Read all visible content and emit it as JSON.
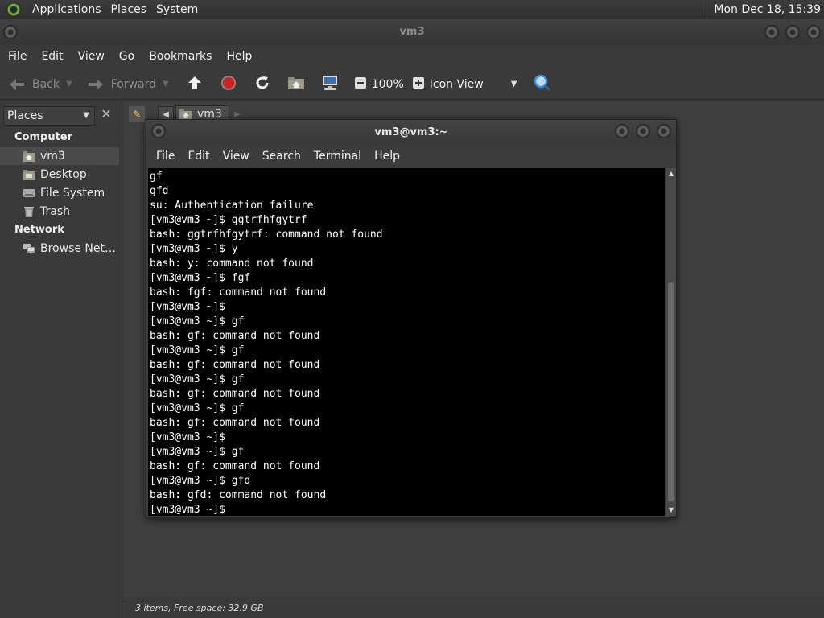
{
  "top_panel": {
    "menus": [
      "Applications",
      "Places",
      "System"
    ],
    "clock": "Mon Dec 18, 15:39"
  },
  "file_manager": {
    "title": "vm3",
    "menus": [
      "File",
      "Edit",
      "View",
      "Go",
      "Bookmarks",
      "Help"
    ],
    "toolbar": {
      "back": "Back",
      "forward": "Forward",
      "zoom": "100%",
      "view_mode": "Icon View"
    },
    "sidebar": {
      "combo": "Places",
      "sections": [
        {
          "heading": "Computer",
          "items": [
            "vm3",
            "Desktop",
            "File System",
            "Trash"
          ]
        },
        {
          "heading": "Network",
          "items": [
            "Browse Net…"
          ]
        }
      ]
    },
    "path": {
      "crumb": "vm3"
    },
    "status": "3 items, Free space: 32.9 GB"
  },
  "terminal": {
    "title": "vm3@vm3:~",
    "menus": [
      "File",
      "Edit",
      "View",
      "Search",
      "Terminal",
      "Help"
    ],
    "lines": [
      "gf",
      "gfd",
      "su: Authentication failure",
      "[vm3@vm3 ~]$ ggtrfhfgytrf",
      "bash: ggtrfhfgytrf: command not found",
      "[vm3@vm3 ~]$ y",
      "bash: y: command not found",
      "[vm3@vm3 ~]$ fgf",
      "bash: fgf: command not found",
      "[vm3@vm3 ~]$",
      "[vm3@vm3 ~]$ gf",
      "bash: gf: command not found",
      "[vm3@vm3 ~]$ gf",
      "bash: gf: command not found",
      "[vm3@vm3 ~]$ gf",
      "bash: gf: command not found",
      "[vm3@vm3 ~]$ gf",
      "bash: gf: command not found",
      "[vm3@vm3 ~]$",
      "[vm3@vm3 ~]$ gf",
      "bash: gf: command not found",
      "[vm3@vm3 ~]$ gfd",
      "bash: gfd: command not found",
      "[vm3@vm3 ~]$"
    ]
  },
  "colors": {
    "panel_bg": "#2f2f2f",
    "window_bg": "#3a3a3a",
    "terminal_bg": "#000000",
    "terminal_fg": "#ffffff",
    "stop_red": "#cc2222",
    "search_blue": "#3a8fd8"
  }
}
